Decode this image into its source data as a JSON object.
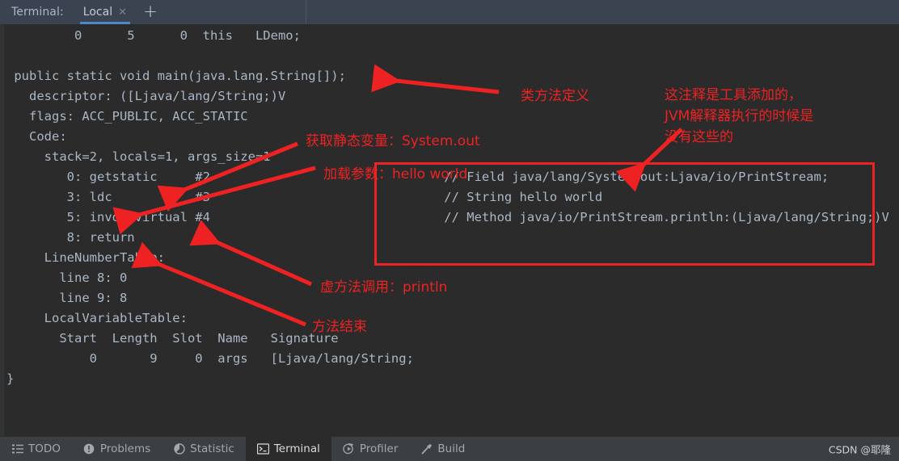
{
  "window": {
    "terminal_label": "Terminal:",
    "tabs": [
      {
        "label": "Local",
        "close_icon": "✕",
        "active": true
      }
    ],
    "add_tab_icon": "+"
  },
  "console": {
    "lines": [
      "         0      5      0  this   LDemo;",
      "",
      " public static void main(java.lang.String[]);",
      "   descriptor: ([Ljava/lang/String;)V",
      "   flags: ACC_PUBLIC, ACC_STATIC",
      "   Code:",
      "     stack=2, locals=1, args_size=1",
      "        0: getstatic     #2",
      "        3: ldc           #3",
      "        5: invokevirtual #4",
      "        8: return",
      "     LineNumberTable:",
      "       line 8: 0",
      "       line 9: 8",
      "     LocalVariableTable:",
      "       Start  Length  Slot  Name   Signature",
      "           0       9     0  args   [Ljava/lang/String;",
      "}"
    ],
    "comment_box_lines": [
      "// Field java/lang/System.out:Ljava/io/PrintStream;",
      "// String hello world",
      "// Method java/io/PrintStream.println:(Ljava/lang/String;)V"
    ]
  },
  "annotations": {
    "color": "#ee2222",
    "items": [
      {
        "id": "class-method-definition",
        "text": "类方法定义"
      },
      {
        "id": "get-static-variable",
        "text": "获取静态变量：System.out"
      },
      {
        "id": "load-parameter",
        "text": "加载参数：hello world"
      },
      {
        "id": "virtual-method-call",
        "text": "虚方法调用：println"
      },
      {
        "id": "method-end",
        "text": "方法结束"
      },
      {
        "id": "tool-added-comment",
        "text": "这注释是工具添加的，\nJVM解释器执行的时候是\n没有这些的"
      }
    ]
  },
  "statusbar": {
    "items": [
      {
        "label": "TODO",
        "icon": "list-icon",
        "active": false
      },
      {
        "label": "Problems",
        "icon": "warning-icon",
        "active": false
      },
      {
        "label": "Statistic",
        "icon": "pie-chart-icon",
        "active": false
      },
      {
        "label": "Terminal",
        "icon": "terminal-icon",
        "active": true
      },
      {
        "label": "Profiler",
        "icon": "profiler-icon",
        "active": false
      },
      {
        "label": "Build",
        "icon": "hammer-icon",
        "active": false
      }
    ],
    "watermark": "CSDN @耶隆"
  }
}
